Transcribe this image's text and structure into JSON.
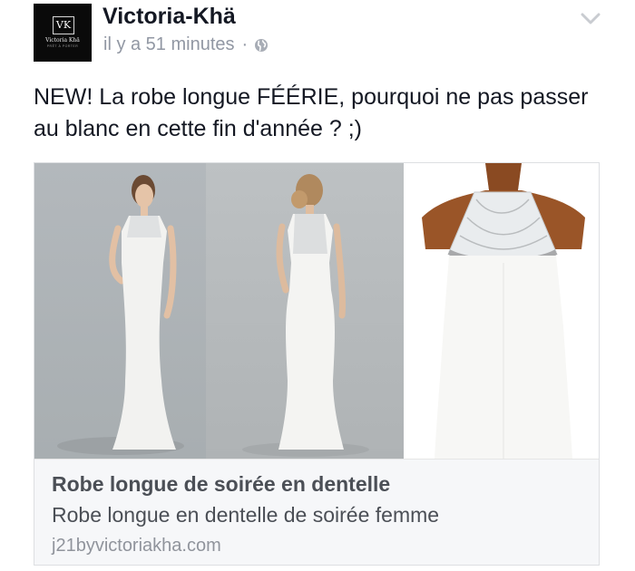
{
  "post": {
    "avatar": {
      "monogram": "VK",
      "brand": "Victoria Khä",
      "tagline": "PRÊT À PORTER"
    },
    "page_name": "Victoria-Khä",
    "timestamp": "il y a 51 minutes",
    "separator": "·",
    "audience_icon": "globe-icon",
    "menu_icon": "chevron-down-icon",
    "text": "NEW! La robe longue FÉÉRIE, pourquoi ne pas passer au blanc en cette fin d'année ? ;)"
  },
  "link_card": {
    "images": [
      "model-front-photo",
      "model-back-photo",
      "dress-mannequin-photo"
    ],
    "title": "Robe longue de soirée en dentelle",
    "description": "Robe longue en dentelle de soirée femme",
    "domain": "j21byvictoriakha.com"
  },
  "colors": {
    "text": "#141823",
    "meta": "#9197a3",
    "card_bg": "#f6f7f9",
    "card_border": "#dddfe2"
  }
}
